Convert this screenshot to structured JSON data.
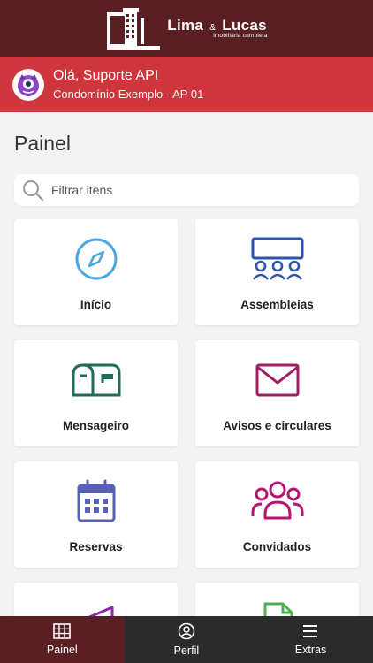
{
  "header": {
    "logo_name": "Lima",
    "logo_amp": "&",
    "logo_name2": "Lucas",
    "logo_sub": "imobiliária completa",
    "brand_color": "#5a1f22"
  },
  "user": {
    "greeting": "Olá, Suporte API",
    "condo": "Condomínio Exemplo - AP 01",
    "bar_color": "#cf353c"
  },
  "main": {
    "title": "Painel",
    "search_placeholder": "Filtrar itens",
    "cards": [
      {
        "label": "Início",
        "icon": "compass-icon",
        "color": "#4aa6e0"
      },
      {
        "label": "Assembleias",
        "icon": "meeting-icon",
        "color": "#2e55a8"
      },
      {
        "label": "Mensageiro",
        "icon": "mailbox-icon",
        "color": "#1f6b5a"
      },
      {
        "label": "Avisos e circulares",
        "icon": "envelope-icon",
        "color": "#9c1f63"
      },
      {
        "label": "Reservas",
        "icon": "calendar-icon",
        "color": "#5861b3"
      },
      {
        "label": "Convidados",
        "icon": "users-icon",
        "color": "#b2166e"
      },
      {
        "label": "",
        "icon": "megaphone-icon",
        "color": "#8a2aa8"
      },
      {
        "label": "",
        "icon": "document-icon",
        "color": "#4caf50"
      }
    ]
  },
  "nav": {
    "items": [
      {
        "label": "Painel",
        "icon": "grid-icon",
        "active": true
      },
      {
        "label": "Perfil",
        "icon": "profile-icon",
        "active": false
      },
      {
        "label": "Extras",
        "icon": "menu-icon",
        "active": false
      }
    ]
  }
}
